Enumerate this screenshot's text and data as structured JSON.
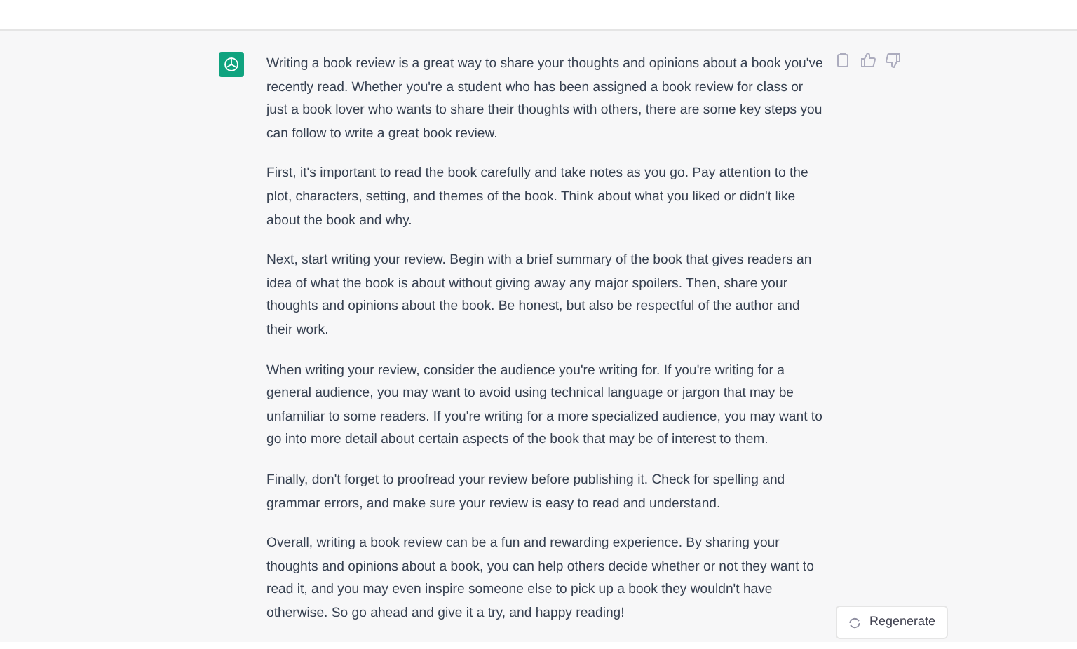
{
  "message": {
    "paragraphs": [
      "Writing a book review is a great way to share your thoughts and opinions about a book you've recently read. Whether you're a student who has been assigned a book review for class or just a book lover who wants to share their thoughts with others, there are some key steps you can follow to write a great book review.",
      "First, it's important to read the book carefully and take notes as you go. Pay attention to the plot, characters, setting, and themes of the book. Think about what you liked or didn't like about the book and why.",
      "Next, start writing your review. Begin with a brief summary of the book that gives readers an idea of what the book is about without giving away any major spoilers. Then, share your thoughts and opinions about the book. Be honest, but also be respectful of the author and their work.",
      "When writing your review, consider the audience you're writing for. If you're writing for a general audience, you may want to avoid using technical language or jargon that may be unfamiliar to some readers. If you're writing for a more specialized audience, you may want to go into more detail about certain aspects of the book that may be of interest to them.",
      "Finally, don't forget to proofread your review before publishing it. Check for spelling and grammar errors, and make sure your review is easy to read and understand.",
      "Overall, writing a book review can be a fun and rewarding experience. By sharing your thoughts and opinions about a book, you can help others decide whether or not they want to read it, and you may even inspire someone else to pick up a book they wouldn't have otherwise. So go ahead and give it a try, and happy reading!"
    ]
  },
  "regenerate_button": {
    "label": "Regenerate"
  }
}
